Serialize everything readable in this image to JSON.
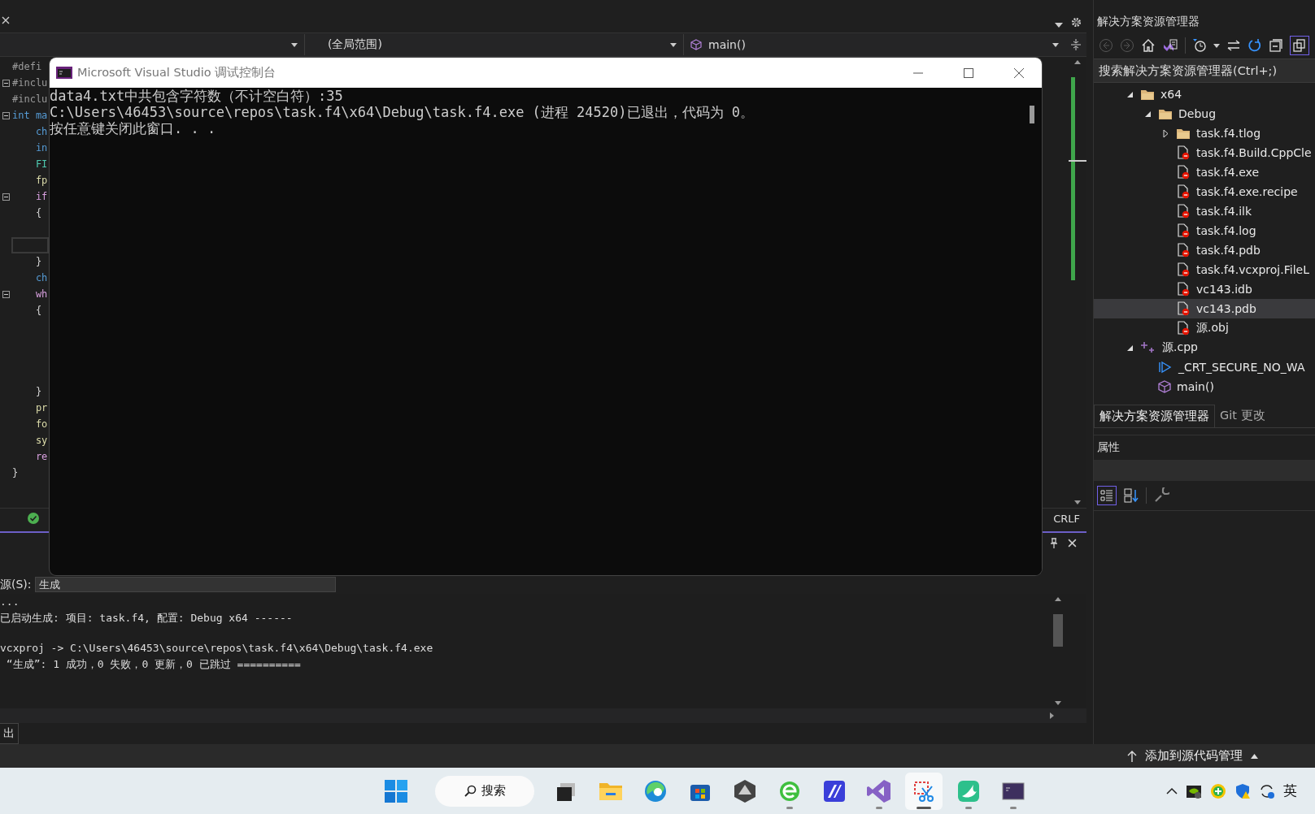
{
  "editor": {
    "scope": "(全局范围)",
    "member": "main()",
    "line_ending": "CRLF",
    "lines": [
      {
        "text": "#defi",
        "kind": "directive",
        "fold": false,
        "current": false
      },
      {
        "text": "#inclu",
        "kind": "directive",
        "fold": true,
        "current": false
      },
      {
        "text": "#inclu",
        "kind": "directive",
        "fold": false,
        "current": false
      },
      {
        "text": "int ma",
        "kind": "keyword",
        "fold": true,
        "current": false
      },
      {
        "text": "    ch",
        "kind": "type",
        "fold": false,
        "current": false
      },
      {
        "text": "    in",
        "kind": "type",
        "fold": false,
        "current": false
      },
      {
        "text": "    FI",
        "kind": "class",
        "fold": false,
        "current": false
      },
      {
        "text": "    fp",
        "kind": "function",
        "fold": false,
        "current": false
      },
      {
        "text": "    if",
        "kind": "control",
        "fold": true,
        "current": false
      },
      {
        "text": "    {",
        "kind": "text",
        "fold": false,
        "current": false
      },
      {
        "kind": "blank",
        "fold": false,
        "current": false
      },
      {
        "kind": "blank",
        "fold": false,
        "current": true
      },
      {
        "text": "    }",
        "kind": "text",
        "fold": false,
        "current": false
      },
      {
        "text": "    ch",
        "kind": "type",
        "fold": false,
        "current": false
      },
      {
        "text": "    wh",
        "kind": "control",
        "fold": true,
        "current": false
      },
      {
        "text": "    {",
        "kind": "text",
        "fold": false,
        "current": false
      },
      {
        "kind": "blank",
        "fold": false,
        "current": false
      },
      {
        "kind": "blank",
        "fold": false,
        "current": false
      },
      {
        "kind": "blank",
        "fold": false,
        "current": false
      },
      {
        "kind": "blank",
        "fold": false,
        "current": false
      },
      {
        "text": "    }",
        "kind": "text",
        "fold": false,
        "current": false
      },
      {
        "text": "    pr",
        "kind": "function",
        "fold": false,
        "current": false
      },
      {
        "text": "    fo",
        "kind": "function",
        "fold": false,
        "current": false
      },
      {
        "text": "    sy",
        "kind": "function",
        "fold": false,
        "current": false
      },
      {
        "text": "    re",
        "kind": "control",
        "fold": false,
        "current": false
      },
      {
        "text": "}",
        "kind": "text",
        "fold": false,
        "current": false
      }
    ]
  },
  "console": {
    "title": "Microsoft Visual Studio 调试控制台",
    "lines": [
      "data4.txt中共包含字符数（不计空白符）:35",
      "C:\\Users\\46453\\source\\repos\\task.f4\\x64\\Debug\\task.f4.exe (进程 24520)已退出，代码为 0。",
      "按任意键关闭此窗口. . ."
    ]
  },
  "output": {
    "source_label": "源(S):",
    "source": "生成",
    "lines": [
      {
        "kind": "text",
        "text": "..."
      },
      {
        "kind": "text",
        "text": "已启动生成: 项目: task.f4, 配置: Debug x64 ------"
      },
      {
        "kind": "blank"
      },
      {
        "kind": "text",
        "text": "vcxproj -> C:\\Users\\46453\\source\\repos\\task.f4\\x64\\Debug\\task.f4.exe"
      },
      {
        "kind": "text",
        "text": " “生成”: 1 成功，0 失败，0 更新，0 已跳过 =========="
      }
    ],
    "tab": "出"
  },
  "solution_explorer": {
    "title": "解决方案资源管理器",
    "search": {
      "placeholder": "搜索解决方案资源管理器(Ctrl+;)"
    },
    "tree": [
      {
        "label": "x64",
        "kind": "folder",
        "expanded": true,
        "selected": false,
        "children": [
          {
            "label": "Debug",
            "kind": "folder",
            "expanded": true,
            "selected": false,
            "children": [
              {
                "label": "task.f4.tlog",
                "kind": "folder",
                "expanded": false,
                "selected": false
              },
              {
                "label": "task.f4.Build.CppCle",
                "kind": "file",
                "selected": false
              },
              {
                "label": "task.f4.exe",
                "kind": "file",
                "selected": false
              },
              {
                "label": "task.f4.exe.recipe",
                "kind": "file",
                "selected": false
              },
              {
                "label": "task.f4.ilk",
                "kind": "file",
                "selected": false
              },
              {
                "label": "task.f4.log",
                "kind": "file",
                "selected": false
              },
              {
                "label": "task.f4.pdb",
                "kind": "file",
                "selected": false
              },
              {
                "label": "task.f4.vcxproj.FileL",
                "kind": "file",
                "selected": false
              },
              {
                "label": "vc143.idb",
                "kind": "file",
                "selected": false
              },
              {
                "label": "vc143.pdb",
                "kind": "file",
                "selected": true
              },
              {
                "label": "源.obj",
                "kind": "file",
                "selected": false
              }
            ]
          }
        ]
      },
      {
        "label": "源.cpp",
        "kind": "cpp",
        "expanded": true,
        "selected": false,
        "children": [
          {
            "label": "_CRT_SECURE_NO_WA",
            "kind": "macro",
            "selected": false
          },
          {
            "label": "main()",
            "kind": "function",
            "selected": false
          }
        ]
      }
    ],
    "tabs": [
      {
        "label": "解决方案资源管理器",
        "selected": true
      },
      {
        "label": "Git 更改",
        "selected": false
      }
    ]
  },
  "properties": {
    "title": "属性"
  },
  "status_bar": {
    "source_control": "添加到源代码管理"
  },
  "taskbar": {
    "search": "搜索",
    "input_method": "英",
    "apps": [
      {
        "kind": "taskview",
        "running": false,
        "selected": false
      },
      {
        "kind": "folder",
        "running": false,
        "selected": false
      },
      {
        "kind": "browser",
        "running": false,
        "selected": false
      },
      {
        "kind": "store",
        "running": false,
        "selected": false
      },
      {
        "kind": "cube",
        "running": false,
        "selected": false
      },
      {
        "kind": "globe",
        "running": true,
        "selected": false
      },
      {
        "kind": "editor",
        "running": false,
        "selected": false
      },
      {
        "kind": "vs",
        "running": true,
        "selected": false
      },
      {
        "kind": "snip",
        "running": true,
        "selected": true
      },
      {
        "kind": "bird",
        "running": true,
        "selected": false
      },
      {
        "kind": "terminal",
        "running": true,
        "selected": false
      }
    ]
  }
}
